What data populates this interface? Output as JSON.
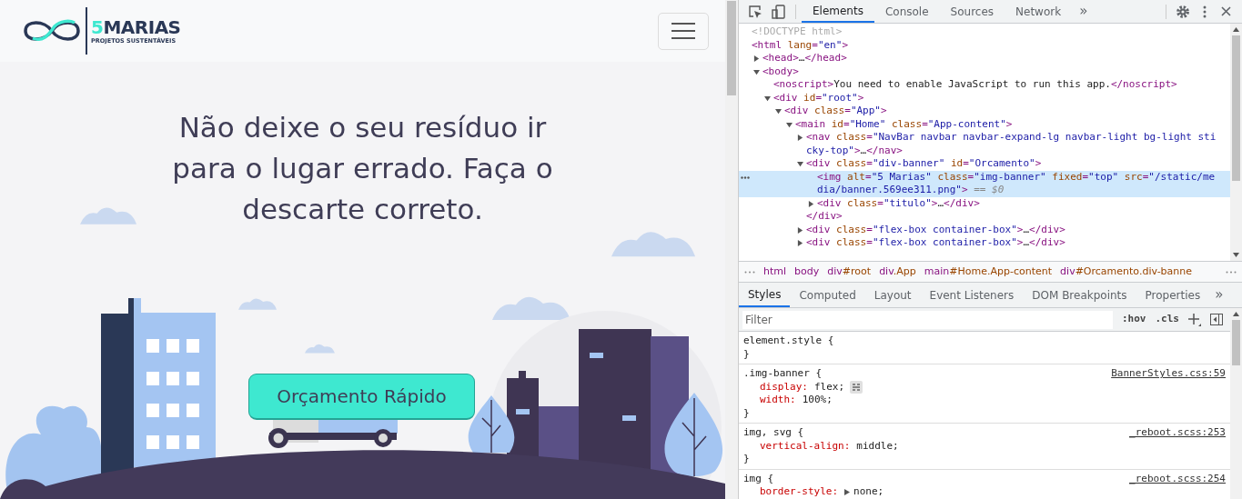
{
  "page": {
    "logo": {
      "digit": "5",
      "name": "MARIAS",
      "tagline": "PROJETOS SUSTENTÁVEIS"
    },
    "headline": "Não deixe o seu resíduo ir para o lugar errado. Faça o descarte correto.",
    "cta_button": "Orçamento Rápido"
  },
  "devtools": {
    "tabs": [
      {
        "label": "Elements",
        "selected": true
      },
      {
        "label": "Console",
        "selected": false
      },
      {
        "label": "Sources",
        "selected": false
      },
      {
        "label": "Network",
        "selected": false
      }
    ],
    "overflow": "»",
    "dom_tree": [
      {
        "text": "<!DOCTYPE html>",
        "kind": "doctype",
        "selected": false
      },
      {
        "text": "<html lang=\"en\">",
        "kind": "element",
        "selected": false,
        "children": [
          {
            "text": "<head>…</head>",
            "kind": "element",
            "expanded": false,
            "selected": false
          },
          {
            "text": "<body>",
            "kind": "element",
            "expanded": true,
            "selected": false,
            "children": [
              {
                "text": "<noscript>You need to enable JavaScript to run this app.</noscript>",
                "kind": "element",
                "selected": false
              },
              {
                "text": "<div id=\"root\">",
                "kind": "element",
                "expanded": true,
                "selected": false,
                "children": [
                  {
                    "text": "<div class=\"App\">",
                    "kind": "element",
                    "expanded": true,
                    "selected": false,
                    "children": [
                      {
                        "text": "<main id=\"Home\" class=\"App-content\">",
                        "kind": "element",
                        "expanded": true,
                        "selected": false,
                        "children": [
                          {
                            "text": "<nav class=\"NavBar navbar navbar-expand-lg navbar-light bg-light sticky-top\">…</nav>",
                            "kind": "element",
                            "expanded": false,
                            "selected": false
                          },
                          {
                            "text": "<div class=\"div-banner\" id=\"Orcamento\">",
                            "kind": "element",
                            "expanded": true,
                            "selected": false,
                            "closing": "</div>",
                            "children": [
                              {
                                "text": "<img alt=\"5 Marias\" class=\"img-banner\" fixed=\"top\" src=\"/static/media/banner.569ee311.png\">",
                                "kind": "element",
                                "selected": true,
                                "console_ref": "== $0"
                              },
                              {
                                "text": "<div class=\"titulo\">…</div>",
                                "kind": "element",
                                "expanded": false,
                                "selected": false
                              }
                            ]
                          },
                          {
                            "text": "<div class=\"flex-box container-box\">…</div>",
                            "kind": "element",
                            "expanded": false,
                            "selected": false
                          },
                          {
                            "text": "<div class=\"flex-box container-box\">…</div>",
                            "kind": "element",
                            "expanded": false,
                            "selected": false
                          }
                        ]
                      }
                    ]
                  }
                ]
              }
            ]
          }
        ]
      }
    ],
    "breadcrumbs": [
      {
        "tag": "html"
      },
      {
        "tag": "body"
      },
      {
        "tag": "div",
        "rest": "#root"
      },
      {
        "tag": "div",
        "rest": ".App"
      },
      {
        "tag": "main",
        "rest": "#Home.App-content"
      },
      {
        "tag": "div",
        "rest": "#Orcamento.div-banne"
      }
    ],
    "style_tabs": [
      {
        "label": "Styles",
        "selected": true
      },
      {
        "label": "Computed",
        "selected": false
      },
      {
        "label": "Layout",
        "selected": false
      },
      {
        "label": "Event Listeners",
        "selected": false
      },
      {
        "label": "DOM Breakpoints",
        "selected": false
      },
      {
        "label": "Properties",
        "selected": false
      }
    ],
    "filter": {
      "placeholder": "Filter"
    },
    "filter_buttons": [
      ":hov",
      ".cls"
    ],
    "rules": [
      {
        "selector": "element.style {",
        "close": "}"
      },
      {
        "selector": ".img-banner {",
        "source": "BannerStyles.css:59",
        "declarations": [
          {
            "property": "display:",
            "value": "flex;",
            "grid_badge": true
          },
          {
            "property": "width:",
            "value": "100%;"
          }
        ],
        "close": "}"
      },
      {
        "selector": "img, svg {",
        "source": "_reboot.scss:253",
        "declarations": [
          {
            "property": "vertical-align:",
            "value": "middle;"
          }
        ],
        "close": "}"
      },
      {
        "selector": "img {",
        "source": "_reboot.scss:254",
        "declarations": [
          {
            "property": "border-style:",
            "value": "none;",
            "expandable": true
          }
        ]
      }
    ]
  }
}
